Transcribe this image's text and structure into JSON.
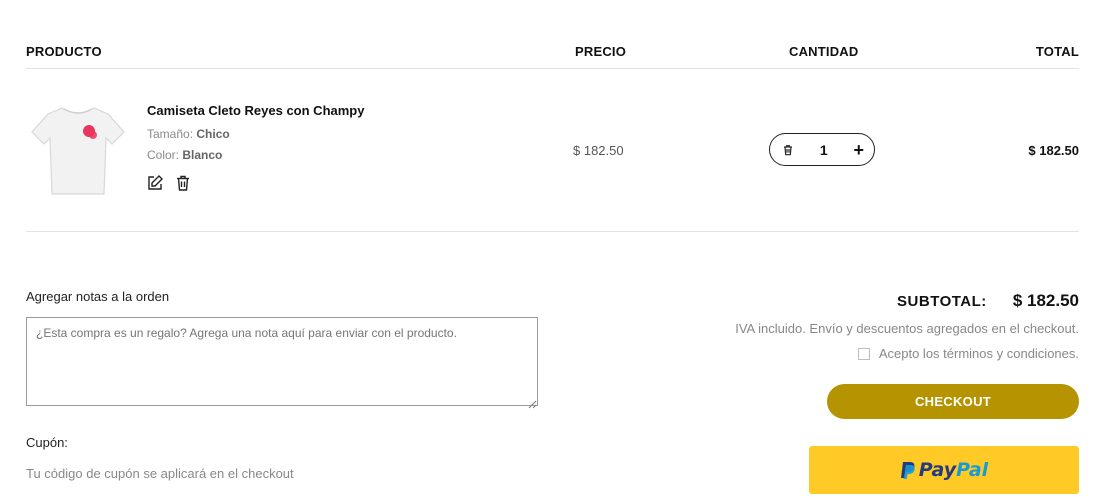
{
  "table": {
    "headers": {
      "product": "PRODUCTO",
      "price": "PRECIO",
      "quantity": "CANTIDAD",
      "total": "TOTAL"
    }
  },
  "item": {
    "name": "Camiseta Cleto Reyes con Champy",
    "size_label": "Tamaño:",
    "size_value": "Chico",
    "color_label": "Color:",
    "color_value": "Blanco",
    "price": "$ 182.50",
    "quantity": "1",
    "total": "$ 182.50",
    "icons": {
      "image": "t-shirt-image",
      "edit": "edit-icon",
      "delete": "trash-icon",
      "qty_delete": "trash-icon",
      "qty_plus": "plus-icon"
    },
    "qty_plus_symbol": "+"
  },
  "notes": {
    "label": "Agregar notas a la orden",
    "placeholder": "¿Esta compra es un regalo? Agrega una nota aquí para enviar con el producto."
  },
  "coupon": {
    "label": "Cupón:",
    "text": "Tu código de cupón se aplicará en el checkout"
  },
  "summary": {
    "subtotal_label": "SUBTOTAL:",
    "subtotal_value": "$ 182.50",
    "tax_note": "IVA incluido. Envío y descuentos agregados en el checkout.",
    "terms_label": "Acepto los términos y condiciones.",
    "terms_checked": false,
    "checkout_label": "CHECKOUT",
    "paypal_part1": "Pay",
    "paypal_part2": "Pal"
  },
  "colors": {
    "checkout_bg": "#b69300",
    "paypal_bg": "#ffc926",
    "paypal_dark": "#253b80",
    "paypal_light": "#179bd7",
    "logo_accent": "#e8365d"
  }
}
